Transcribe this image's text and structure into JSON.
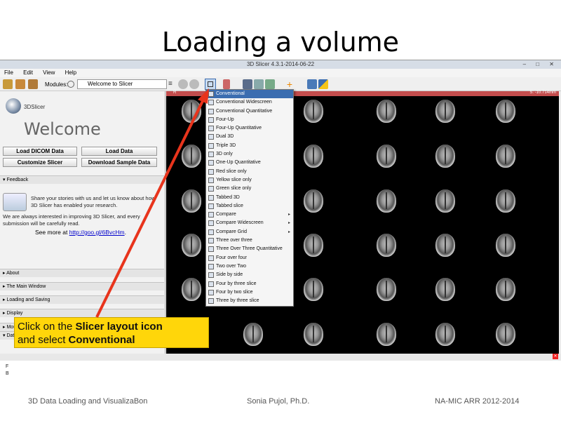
{
  "slide": {
    "title": "Loading a volume",
    "footer_left": "3D Data Loading and VisualizaBon",
    "footer_center": "Sonia Pujol, Ph.D.",
    "footer_right": "NA-MIC ARR 2012-2014"
  },
  "window": {
    "title": "3D Slicer 4.3.1-2014-06-22",
    "controls": "– □ ✕"
  },
  "menu": [
    "File",
    "Edit",
    "View",
    "Help"
  ],
  "toolbar": {
    "modules_label": "Modules:",
    "module_selected": "Welcome to Slicer"
  },
  "left_panel": {
    "logo_text": "3DSlicer",
    "welcome": "Welcome",
    "buttons": {
      "load_dicom": "Load DICOM Data",
      "load_data": "Load Data",
      "customize": "Customize Slicer",
      "download_sample": "Download Sample Data"
    },
    "feedback_header": "Feedback",
    "share_text": "Share your stories with us and let us know about how 3D Slicer has enabled your research.",
    "improve_text": "We are always interested in improving 3D Slicer, and every submission will be carefully read.",
    "see_more_prefix": "See more at ",
    "see_more_link": "http://goo.gl/6BvcHm",
    "see_more_suffix": ".",
    "sections": [
      "About",
      "The Main Window",
      "Loading and Saving",
      "Display",
      "Mouse & Keyboard",
      "Data Probe"
    ],
    "probe_letters": [
      "L",
      "F",
      "B"
    ]
  },
  "viewer": {
    "slice_label": "R",
    "slice_value": "S: -10.714mm"
  },
  "layout_menu": {
    "items": [
      {
        "label": "Conventional",
        "selected": true,
        "submenu": false
      },
      {
        "label": "Conventional Widescreen",
        "selected": false,
        "submenu": false
      },
      {
        "label": "Conventional Quantitative",
        "selected": false,
        "submenu": false
      },
      {
        "label": "Four-Up",
        "selected": false,
        "submenu": false
      },
      {
        "label": "Four-Up Quantitative",
        "selected": false,
        "submenu": false
      },
      {
        "label": "Dual 3D",
        "selected": false,
        "submenu": false
      },
      {
        "label": "Triple 3D",
        "selected": false,
        "submenu": false
      },
      {
        "label": "3D only",
        "selected": false,
        "submenu": false
      },
      {
        "label": "One-Up Quantitative",
        "selected": false,
        "submenu": false
      },
      {
        "label": "Red slice only",
        "selected": false,
        "submenu": false
      },
      {
        "label": "Yellow slice only",
        "selected": false,
        "submenu": false
      },
      {
        "label": "Green slice only",
        "selected": false,
        "submenu": false
      },
      {
        "label": "Tabbed 3D",
        "selected": false,
        "submenu": false
      },
      {
        "label": "Tabbed slice",
        "selected": false,
        "submenu": false
      },
      {
        "label": "Compare",
        "selected": false,
        "submenu": true
      },
      {
        "label": "Compare Widescreen",
        "selected": false,
        "submenu": true
      },
      {
        "label": "Compare Grid",
        "selected": false,
        "submenu": true
      },
      {
        "label": "Three over three",
        "selected": false,
        "submenu": false
      },
      {
        "label": "Three Over Three Quantitative",
        "selected": false,
        "submenu": false
      },
      {
        "label": "Four over four",
        "selected": false,
        "submenu": false
      },
      {
        "label": "Two over Two",
        "selected": false,
        "submenu": false
      },
      {
        "label": "Side by side",
        "selected": false,
        "submenu": false
      },
      {
        "label": "Four by three slice",
        "selected": false,
        "submenu": false
      },
      {
        "label": "Four by two slice",
        "selected": false,
        "submenu": false
      },
      {
        "label": "Three by three slice",
        "selected": false,
        "submenu": false
      }
    ]
  },
  "callout": {
    "line1_prefix": "Click on the ",
    "line1_bold": "Slicer layout icon",
    "line2_prefix": "and select ",
    "line2_bold": "Conventional"
  },
  "colors": {
    "callout_bg": "#ffd60a",
    "arrow": "#e8341c",
    "slice_bar": "#c34d4d",
    "menu_highlight": "#3b6db0"
  }
}
